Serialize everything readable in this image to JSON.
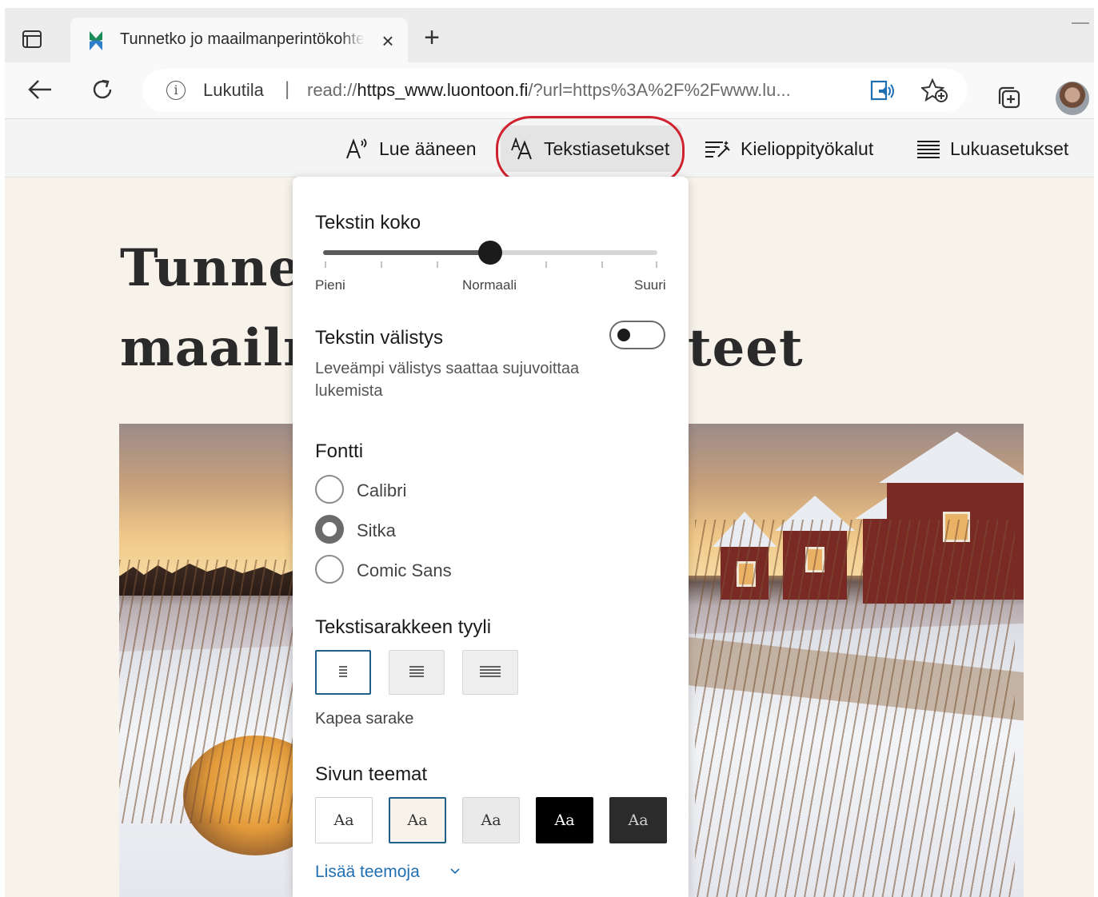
{
  "browser": {
    "tab_title": "Tunnetko jo maailmanperintökohteet",
    "address": {
      "mode_label": "Lukutila",
      "separator": "|",
      "url_prefix": "read://",
      "url_domain": "https_www.luontoon.fi",
      "url_rest": "/?url=https%3A%2F%2Fwww.lu..."
    }
  },
  "reader_toolbar": {
    "items": [
      {
        "label": "Lue ääneen",
        "icon": "read-aloud-icon"
      },
      {
        "label": "Tekstiasetukset",
        "icon": "text-preferences-icon",
        "active": true
      },
      {
        "label": "Kielioppityökalut",
        "icon": "grammar-tools-icon"
      },
      {
        "label": "Lukuasetukset",
        "icon": "reading-preferences-icon"
      }
    ]
  },
  "article": {
    "headline_line1": "Tunne",
    "headline_line2_start": "maailr",
    "headline_line2_end": "teet"
  },
  "text_settings": {
    "size": {
      "heading": "Tekstin koko",
      "min_label": "Pieni",
      "mid_label": "Normaali",
      "max_label": "Suuri",
      "level": 0.5
    },
    "spacing": {
      "heading": "Tekstin välistys",
      "description": "Leveämpi välistys saattaa sujuvoittaa lukemista",
      "enabled": false
    },
    "font": {
      "heading": "Fontti",
      "options": [
        "Calibri",
        "Sitka",
        "Comic Sans"
      ],
      "selected": "Sitka"
    },
    "column_style": {
      "heading": "Tekstisarakkeen tyyli",
      "selected_label": "Kapea sarake"
    },
    "themes": {
      "heading": "Sivun teemat",
      "sample": "Aa",
      "colors": [
        "#ffffff",
        "#f7f3ea",
        "#eaeaea",
        "#000000",
        "#2b2b2b"
      ],
      "more_label": "Lisää teemoja"
    }
  },
  "colors": {
    "accent": "#1f5f8a",
    "highlight_ring": "#d0222e",
    "link": "#1f6fb3"
  }
}
